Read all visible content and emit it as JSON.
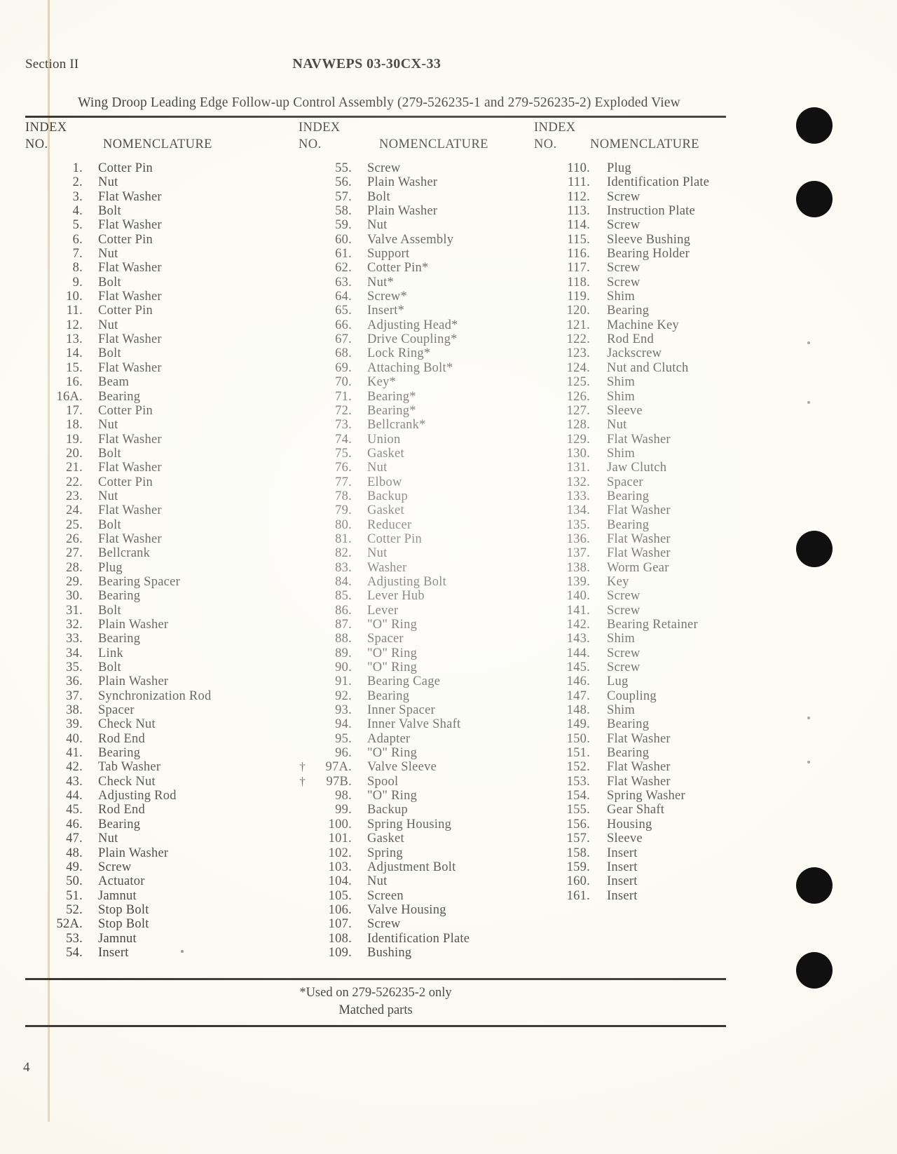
{
  "header": {
    "section": "Section II",
    "doc_number": "NAVWEPS 03-30CX-33"
  },
  "figure_title": "Wing Droop Leading Edge Follow-up Control Assembly (279-526235-1 and 279-526235-2) Exploded View",
  "column_headers": {
    "index": "INDEX",
    "no": "NO.",
    "nomenclature": "NOMENCLATURE"
  },
  "footnote": {
    "line1": "*Used on 279-526235-2 only",
    "line2": "Matched parts"
  },
  "page_number": "4",
  "columns": [
    {
      "entries": [
        {
          "mark": "",
          "num": "1.",
          "nomenclature": "Cotter Pin"
        },
        {
          "mark": "",
          "num": "2.",
          "nomenclature": "Nut"
        },
        {
          "mark": "",
          "num": "3.",
          "nomenclature": "Flat Washer"
        },
        {
          "mark": "",
          "num": "4.",
          "nomenclature": "Bolt"
        },
        {
          "mark": "",
          "num": "5.",
          "nomenclature": "Flat Washer"
        },
        {
          "mark": "",
          "num": "6.",
          "nomenclature": "Cotter Pin"
        },
        {
          "mark": "",
          "num": "7.",
          "nomenclature": "Nut"
        },
        {
          "mark": "",
          "num": "8.",
          "nomenclature": "Flat Washer"
        },
        {
          "mark": "",
          "num": "9.",
          "nomenclature": "Bolt"
        },
        {
          "mark": "",
          "num": "10.",
          "nomenclature": "Flat Washer"
        },
        {
          "mark": "",
          "num": "11.",
          "nomenclature": "Cotter Pin"
        },
        {
          "mark": "",
          "num": "12.",
          "nomenclature": "Nut"
        },
        {
          "mark": "",
          "num": "13.",
          "nomenclature": "Flat Washer"
        },
        {
          "mark": "",
          "num": "14.",
          "nomenclature": "Bolt"
        },
        {
          "mark": "",
          "num": "15.",
          "nomenclature": "Flat Washer"
        },
        {
          "mark": "",
          "num": "16.",
          "nomenclature": "Beam"
        },
        {
          "mark": "",
          "num": "16A.",
          "nomenclature": "Bearing"
        },
        {
          "mark": "",
          "num": "17.",
          "nomenclature": "Cotter Pin"
        },
        {
          "mark": "",
          "num": "18.",
          "nomenclature": "Nut"
        },
        {
          "mark": "",
          "num": "19.",
          "nomenclature": "Flat Washer"
        },
        {
          "mark": "",
          "num": "20.",
          "nomenclature": "Bolt"
        },
        {
          "mark": "",
          "num": "21.",
          "nomenclature": "Flat Washer"
        },
        {
          "mark": "",
          "num": "22.",
          "nomenclature": "Cotter Pin"
        },
        {
          "mark": "",
          "num": "23.",
          "nomenclature": "Nut"
        },
        {
          "mark": "",
          "num": "24.",
          "nomenclature": "Flat Washer"
        },
        {
          "mark": "",
          "num": "25.",
          "nomenclature": "Bolt"
        },
        {
          "mark": "",
          "num": "26.",
          "nomenclature": "Flat Washer"
        },
        {
          "mark": "",
          "num": "27.",
          "nomenclature": "Bellcrank"
        },
        {
          "mark": "",
          "num": "28.",
          "nomenclature": "Plug"
        },
        {
          "mark": "",
          "num": "29.",
          "nomenclature": "Bearing Spacer"
        },
        {
          "mark": "",
          "num": "30.",
          "nomenclature": "Bearing"
        },
        {
          "mark": "",
          "num": "31.",
          "nomenclature": "Bolt"
        },
        {
          "mark": "",
          "num": "32.",
          "nomenclature": "Plain Washer"
        },
        {
          "mark": "",
          "num": "33.",
          "nomenclature": "Bearing"
        },
        {
          "mark": "",
          "num": "34.",
          "nomenclature": "Link"
        },
        {
          "mark": "",
          "num": "35.",
          "nomenclature": "Bolt"
        },
        {
          "mark": "",
          "num": "36.",
          "nomenclature": "Plain Washer"
        },
        {
          "mark": "",
          "num": "37.",
          "nomenclature": "Synchronization Rod"
        },
        {
          "mark": "",
          "num": "38.",
          "nomenclature": "Spacer"
        },
        {
          "mark": "",
          "num": "39.",
          "nomenclature": "Check Nut"
        },
        {
          "mark": "",
          "num": "40.",
          "nomenclature": "Rod End"
        },
        {
          "mark": "",
          "num": "41.",
          "nomenclature": "Bearing"
        },
        {
          "mark": "",
          "num": "42.",
          "nomenclature": "Tab Washer"
        },
        {
          "mark": "",
          "num": "43.",
          "nomenclature": "Check Nut"
        },
        {
          "mark": "",
          "num": "44.",
          "nomenclature": "Adjusting Rod"
        },
        {
          "mark": "",
          "num": "45.",
          "nomenclature": "Rod End"
        },
        {
          "mark": "",
          "num": "46.",
          "nomenclature": "Bearing"
        },
        {
          "mark": "",
          "num": "47.",
          "nomenclature": "Nut"
        },
        {
          "mark": "",
          "num": "48.",
          "nomenclature": "Plain Washer"
        },
        {
          "mark": "",
          "num": "49.",
          "nomenclature": "Screw"
        },
        {
          "mark": "",
          "num": "50.",
          "nomenclature": "Actuator"
        },
        {
          "mark": "",
          "num": "51.",
          "nomenclature": "Jamnut"
        },
        {
          "mark": "",
          "num": "52.",
          "nomenclature": "Stop Bolt"
        },
        {
          "mark": "",
          "num": "52A.",
          "nomenclature": "Stop Bolt"
        },
        {
          "mark": "",
          "num": "53.",
          "nomenclature": "Jamnut"
        },
        {
          "mark": "",
          "num": "54.",
          "nomenclature": "Insert"
        }
      ]
    },
    {
      "entries": [
        {
          "mark": "",
          "num": "55.",
          "nomenclature": "Screw"
        },
        {
          "mark": "",
          "num": "56.",
          "nomenclature": "Plain Washer"
        },
        {
          "mark": "",
          "num": "57.",
          "nomenclature": "Bolt"
        },
        {
          "mark": "",
          "num": "58.",
          "nomenclature": "Plain Washer"
        },
        {
          "mark": "",
          "num": "59.",
          "nomenclature": "Nut"
        },
        {
          "mark": "",
          "num": "60.",
          "nomenclature": "Valve Assembly"
        },
        {
          "mark": "",
          "num": "61.",
          "nomenclature": "Support"
        },
        {
          "mark": "",
          "num": "62.",
          "nomenclature": "Cotter Pin*"
        },
        {
          "mark": "",
          "num": "63.",
          "nomenclature": "Nut*"
        },
        {
          "mark": "",
          "num": "64.",
          "nomenclature": "Screw*"
        },
        {
          "mark": "",
          "num": "65.",
          "nomenclature": "Insert*"
        },
        {
          "mark": "",
          "num": "66.",
          "nomenclature": "Adjusting Head*"
        },
        {
          "mark": "",
          "num": "67.",
          "nomenclature": "Drive Coupling*"
        },
        {
          "mark": "",
          "num": "68.",
          "nomenclature": "Lock Ring*"
        },
        {
          "mark": "",
          "num": "69.",
          "nomenclature": "Attaching Bolt*"
        },
        {
          "mark": "",
          "num": "70.",
          "nomenclature": "Key*"
        },
        {
          "mark": "",
          "num": "71.",
          "nomenclature": "Bearing*"
        },
        {
          "mark": "",
          "num": "72.",
          "nomenclature": "Bearing*"
        },
        {
          "mark": "",
          "num": "73.",
          "nomenclature": "Bellcrank*"
        },
        {
          "mark": "",
          "num": "74.",
          "nomenclature": "Union"
        },
        {
          "mark": "",
          "num": "75.",
          "nomenclature": "Gasket"
        },
        {
          "mark": "",
          "num": "76.",
          "nomenclature": "Nut"
        },
        {
          "mark": "",
          "num": "77.",
          "nomenclature": "Elbow"
        },
        {
          "mark": "",
          "num": "78.",
          "nomenclature": "Backup"
        },
        {
          "mark": "",
          "num": "79.",
          "nomenclature": "Gasket"
        },
        {
          "mark": "",
          "num": "80.",
          "nomenclature": "Reducer"
        },
        {
          "mark": "",
          "num": "81.",
          "nomenclature": "Cotter Pin"
        },
        {
          "mark": "",
          "num": "82.",
          "nomenclature": "Nut"
        },
        {
          "mark": "",
          "num": "83.",
          "nomenclature": "Washer"
        },
        {
          "mark": "",
          "num": "84.",
          "nomenclature": "Adjusting Bolt"
        },
        {
          "mark": "",
          "num": "85.",
          "nomenclature": "Lever Hub"
        },
        {
          "mark": "",
          "num": "86.",
          "nomenclature": "Lever"
        },
        {
          "mark": "",
          "num": "87.",
          "nomenclature": "\"O\" Ring"
        },
        {
          "mark": "",
          "num": "88.",
          "nomenclature": "Spacer"
        },
        {
          "mark": "",
          "num": "89.",
          "nomenclature": "\"O\" Ring"
        },
        {
          "mark": "",
          "num": "90.",
          "nomenclature": "\"O\" Ring"
        },
        {
          "mark": "",
          "num": "91.",
          "nomenclature": "Bearing Cage"
        },
        {
          "mark": "",
          "num": "92.",
          "nomenclature": "Bearing"
        },
        {
          "mark": "",
          "num": "93.",
          "nomenclature": "Inner Spacer"
        },
        {
          "mark": "",
          "num": "94.",
          "nomenclature": "Inner Valve Shaft"
        },
        {
          "mark": "",
          "num": "95.",
          "nomenclature": "Adapter"
        },
        {
          "mark": "",
          "num": "96.",
          "nomenclature": "\"O\" Ring"
        },
        {
          "mark": "†",
          "num": "97A.",
          "nomenclature": "Valve Sleeve"
        },
        {
          "mark": "†",
          "num": "97B.",
          "nomenclature": "Spool"
        },
        {
          "mark": "",
          "num": "98.",
          "nomenclature": "\"O\" Ring"
        },
        {
          "mark": "",
          "num": "99.",
          "nomenclature": "Backup"
        },
        {
          "mark": "",
          "num": "100.",
          "nomenclature": "Spring Housing"
        },
        {
          "mark": "",
          "num": "101.",
          "nomenclature": "Gasket"
        },
        {
          "mark": "",
          "num": "102.",
          "nomenclature": "Spring"
        },
        {
          "mark": "",
          "num": "103.",
          "nomenclature": "Adjustment Bolt"
        },
        {
          "mark": "",
          "num": "104.",
          "nomenclature": "Nut"
        },
        {
          "mark": "",
          "num": "105.",
          "nomenclature": "Screen"
        },
        {
          "mark": "",
          "num": "106.",
          "nomenclature": "Valve Housing"
        },
        {
          "mark": "",
          "num": "107.",
          "nomenclature": "Screw"
        },
        {
          "mark": "",
          "num": "108.",
          "nomenclature": "Identification Plate"
        },
        {
          "mark": "",
          "num": "109.",
          "nomenclature": "Bushing"
        }
      ]
    },
    {
      "entries": [
        {
          "mark": "",
          "num": "110.",
          "nomenclature": "Plug"
        },
        {
          "mark": "",
          "num": "111.",
          "nomenclature": "Identification Plate"
        },
        {
          "mark": "",
          "num": "112.",
          "nomenclature": "Screw"
        },
        {
          "mark": "",
          "num": "113.",
          "nomenclature": "Instruction Plate"
        },
        {
          "mark": "",
          "num": "114.",
          "nomenclature": "Screw"
        },
        {
          "mark": "",
          "num": "115.",
          "nomenclature": "Sleeve Bushing"
        },
        {
          "mark": "",
          "num": "116.",
          "nomenclature": "Bearing Holder"
        },
        {
          "mark": "",
          "num": "117.",
          "nomenclature": "Screw"
        },
        {
          "mark": "",
          "num": "118.",
          "nomenclature": "Screw"
        },
        {
          "mark": "",
          "num": "119.",
          "nomenclature": "Shim"
        },
        {
          "mark": "",
          "num": "120.",
          "nomenclature": "Bearing"
        },
        {
          "mark": "",
          "num": "121.",
          "nomenclature": "Machine Key"
        },
        {
          "mark": "",
          "num": "122.",
          "nomenclature": "Rod End"
        },
        {
          "mark": "",
          "num": "123.",
          "nomenclature": "Jackscrew"
        },
        {
          "mark": "",
          "num": "124.",
          "nomenclature": "Nut and Clutch"
        },
        {
          "mark": "",
          "num": "125.",
          "nomenclature": "Shim"
        },
        {
          "mark": "",
          "num": "126.",
          "nomenclature": "Shim"
        },
        {
          "mark": "",
          "num": "127.",
          "nomenclature": "Sleeve"
        },
        {
          "mark": "",
          "num": "128.",
          "nomenclature": "Nut"
        },
        {
          "mark": "",
          "num": "129.",
          "nomenclature": "Flat Washer"
        },
        {
          "mark": "",
          "num": "130.",
          "nomenclature": "Shim"
        },
        {
          "mark": "",
          "num": "131.",
          "nomenclature": "Jaw Clutch"
        },
        {
          "mark": "",
          "num": "132.",
          "nomenclature": "Spacer"
        },
        {
          "mark": "",
          "num": "133.",
          "nomenclature": "Bearing"
        },
        {
          "mark": "",
          "num": "134.",
          "nomenclature": "Flat Washer"
        },
        {
          "mark": "",
          "num": "135.",
          "nomenclature": "Bearing"
        },
        {
          "mark": "",
          "num": "136.",
          "nomenclature": "Flat Washer"
        },
        {
          "mark": "",
          "num": "137.",
          "nomenclature": "Flat Washer"
        },
        {
          "mark": "",
          "num": "138.",
          "nomenclature": "Worm Gear"
        },
        {
          "mark": "",
          "num": "139.",
          "nomenclature": "Key"
        },
        {
          "mark": "",
          "num": "140.",
          "nomenclature": "Screw"
        },
        {
          "mark": "",
          "num": "141.",
          "nomenclature": "Screw"
        },
        {
          "mark": "",
          "num": "142.",
          "nomenclature": "Bearing Retainer"
        },
        {
          "mark": "",
          "num": "143.",
          "nomenclature": "Shim"
        },
        {
          "mark": "",
          "num": "144.",
          "nomenclature": "Screw"
        },
        {
          "mark": "",
          "num": "145.",
          "nomenclature": "Screw"
        },
        {
          "mark": "",
          "num": "146.",
          "nomenclature": "Lug"
        },
        {
          "mark": "",
          "num": "147.",
          "nomenclature": "Coupling"
        },
        {
          "mark": "",
          "num": "148.",
          "nomenclature": "Shim"
        },
        {
          "mark": "",
          "num": "149.",
          "nomenclature": "Bearing"
        },
        {
          "mark": "",
          "num": "150.",
          "nomenclature": "Flat Washer"
        },
        {
          "mark": "",
          "num": "151.",
          "nomenclature": "Bearing"
        },
        {
          "mark": "",
          "num": "152.",
          "nomenclature": "Flat Washer"
        },
        {
          "mark": "",
          "num": "153.",
          "nomenclature": "Flat Washer"
        },
        {
          "mark": "",
          "num": "154.",
          "nomenclature": "Spring Washer"
        },
        {
          "mark": "",
          "num": "155.",
          "nomenclature": "Gear Shaft"
        },
        {
          "mark": "",
          "num": "156.",
          "nomenclature": "Housing"
        },
        {
          "mark": "",
          "num": "157.",
          "nomenclature": "Sleeve"
        },
        {
          "mark": "",
          "num": "158.",
          "nomenclature": "Insert"
        },
        {
          "mark": "",
          "num": "159.",
          "nomenclature": "Insert"
        },
        {
          "mark": "",
          "num": "160.",
          "nomenclature": "Insert"
        },
        {
          "mark": "",
          "num": "161.",
          "nomenclature": "Insert"
        }
      ]
    }
  ]
}
